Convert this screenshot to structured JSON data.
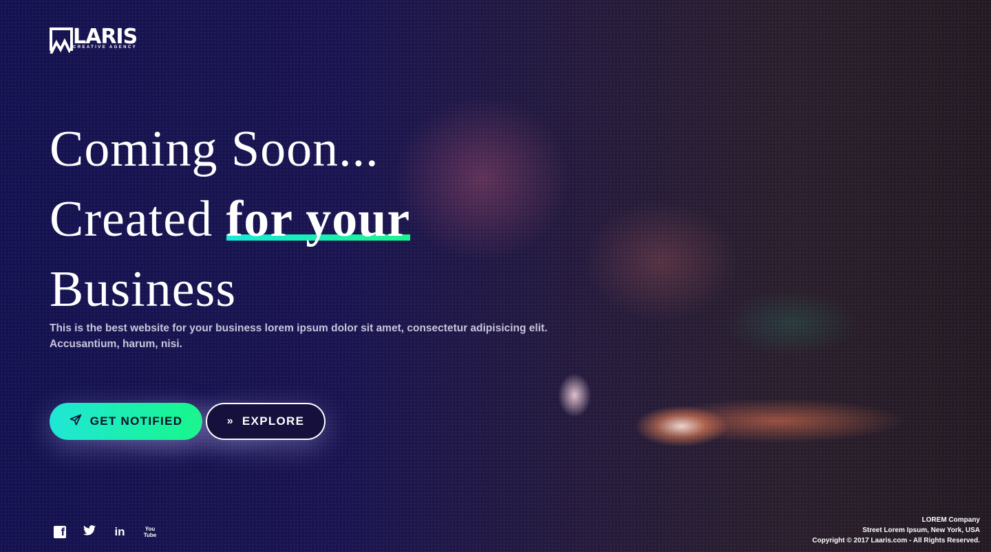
{
  "logo": {
    "name": "LARIS",
    "tagline": "CREATIVE AGENCY"
  },
  "hero": {
    "line1": "Coming Soon...",
    "line2_plain": "Created ",
    "line2_highlight": "for your",
    "line3": "Business",
    "subtitle": "This is the best website for your business lorem ipsum dolor sit amet, consectetur adipisicing elit. Accusantium, harum, nisi.",
    "accent_gradient": [
      "#19e9d8",
      "#1af58d"
    ]
  },
  "buttons": {
    "notify": {
      "label": "GET NOTIFIED",
      "icon": "paper-plane-icon"
    },
    "explore": {
      "label": "EXPLORE",
      "icon": "double-chevron-right-icon"
    }
  },
  "social": [
    {
      "icon": "facebook-icon",
      "glyph": "f"
    },
    {
      "icon": "twitter-icon",
      "glyph": "🐦"
    },
    {
      "icon": "linkedin-icon",
      "glyph": "in"
    },
    {
      "icon": "youtube-icon",
      "glyph": "You Tube"
    }
  ],
  "footer": {
    "company": "LOREM Company",
    "address": "Street Lorem Ipsum, New York, USA",
    "copyright": "Copyright © 2017 Laaris.com - All Rights Reserved."
  }
}
